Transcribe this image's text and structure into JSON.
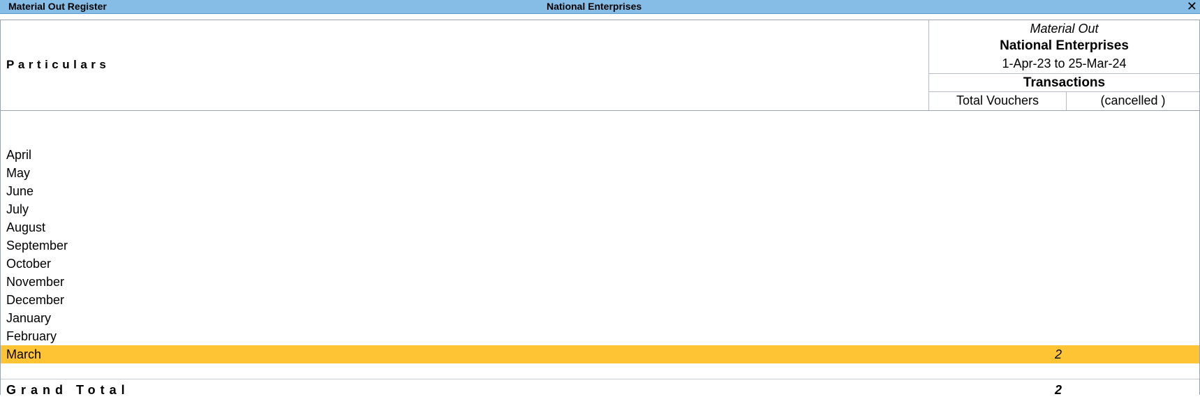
{
  "window": {
    "title": "Material Out Register",
    "company": "National Enterprises",
    "close_glyph": "✕"
  },
  "header": {
    "particulars": "Particulars",
    "voucher_type": "Material Out",
    "company": "National Enterprises",
    "period": "1-Apr-23 to 25-Mar-24",
    "section": "Transactions",
    "columns": [
      "Total Vouchers",
      "(cancelled )"
    ]
  },
  "rows": [
    {
      "name": "April",
      "total": ""
    },
    {
      "name": "May",
      "total": ""
    },
    {
      "name": "June",
      "total": ""
    },
    {
      "name": "July",
      "total": ""
    },
    {
      "name": "August",
      "total": ""
    },
    {
      "name": "September",
      "total": ""
    },
    {
      "name": "October",
      "total": ""
    },
    {
      "name": "November",
      "total": ""
    },
    {
      "name": "December",
      "total": ""
    },
    {
      "name": "January",
      "total": ""
    },
    {
      "name": "February",
      "total": ""
    },
    {
      "name": "March",
      "total": "2"
    }
  ],
  "selected_row": "March",
  "grand_total": {
    "label": "Grand Total",
    "total": "2"
  },
  "colors": {
    "titlebar": "#86bde6",
    "selection": "#fec434"
  }
}
